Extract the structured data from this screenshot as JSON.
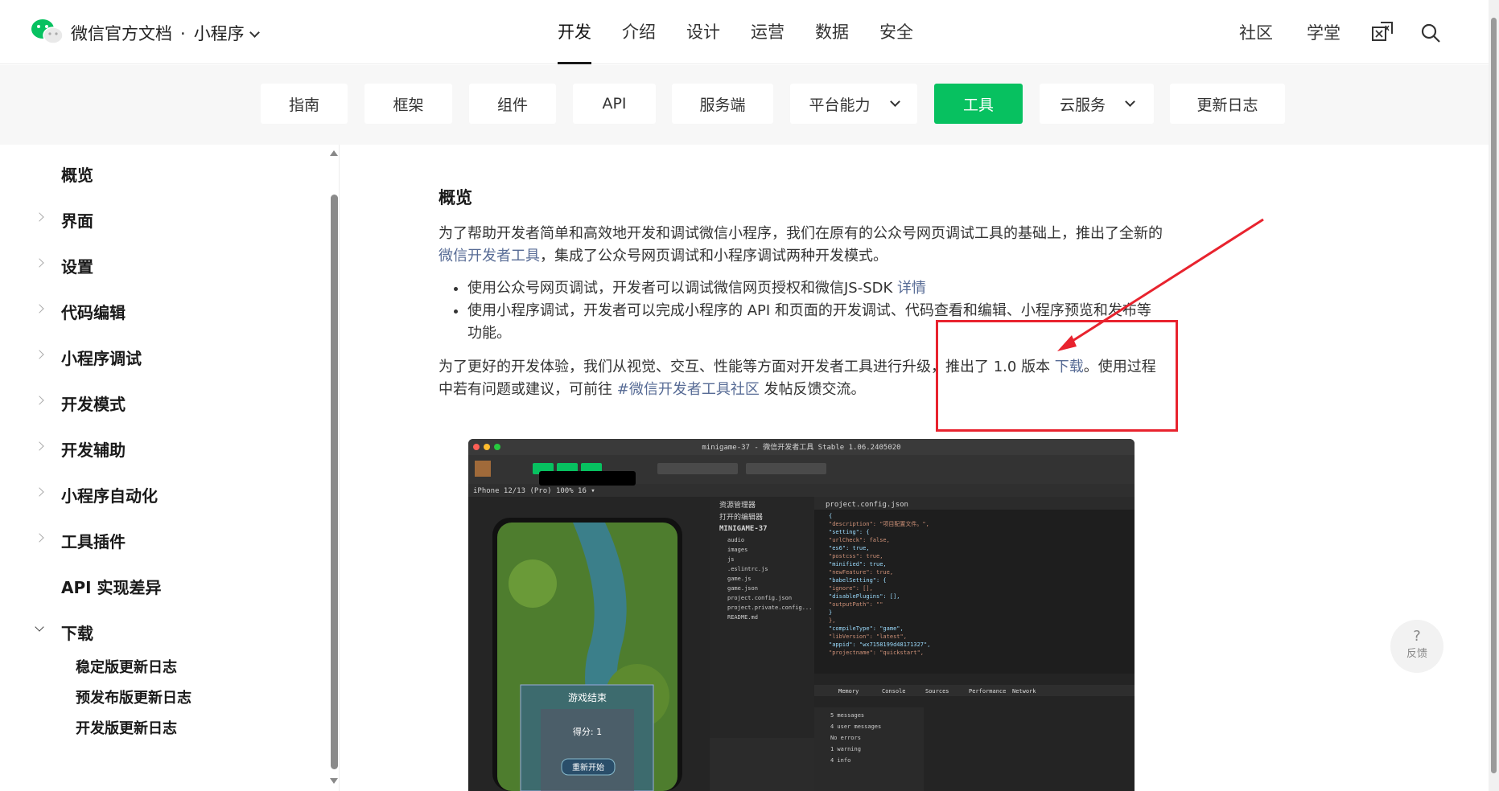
{
  "header": {
    "brand": "微信官方文档",
    "product": "小程序",
    "nav": [
      "开发",
      "介绍",
      "设计",
      "运营",
      "数据",
      "安全"
    ],
    "right": [
      "社区",
      "学堂"
    ]
  },
  "subnav": {
    "items": [
      "指南",
      "框架",
      "组件",
      "API",
      "服务端",
      "平台能力",
      "工具",
      "云服务",
      "更新日志"
    ]
  },
  "sidebar": {
    "items": [
      "概览",
      "界面",
      "设置",
      "代码编辑",
      "小程序调试",
      "开发模式",
      "开发辅助",
      "小程序自动化",
      "工具插件",
      "API 实现差异",
      "下载"
    ],
    "sub_items": [
      "稳定版更新日志",
      "预发布版更新日志",
      "开发版更新日志"
    ]
  },
  "content": {
    "title": "概览",
    "p1_a": "为了帮助开发者简单和高效地开发和调试微信小程序，我们在原有的公众号网页调试工具的基础上，推出了全新的 ",
    "p1_link": "微信开发者工具",
    "p1_b": "，集成了公众号网页调试和小程序调试两种开发模式。",
    "b1_a": "使用公众号网页调试，开发者可以调试微信网页授权和微信JS-SDK ",
    "b1_link": "详情",
    "b2": "使用小程序调试，开发者可以完成小程序的 API 和页面的开发调试、代码查看和编辑、小程序预览和发布等功能。",
    "p2_a": "为了更好的开发体验，我们从视觉、交互、性能等方面对开发者工具进行升级，推出了 1.0 版本 ",
    "p2_link1": "下载",
    "p2_b": "。使用过程中若有问题或建议，可前往 ",
    "p2_link2": "#微信开发者工具社区",
    "p2_c": " 发帖反馈交流。"
  },
  "screenshot": {
    "title": "minigame-37 - 微信开发者工具 Stable 1.06.2405020",
    "device": "iPhone 12/13 (Pro) 100% 16 ▾",
    "tab": "project.config.json",
    "explorer": "资源管理器",
    "open_editors": "打开的编辑器",
    "project": "MINIGAME-37",
    "files": [
      "audio",
      "images",
      "js",
      ".eslintrc.js",
      "game.js",
      "game.json",
      "project.config.json",
      "project.private.config...",
      "README.md"
    ],
    "game_over": "游戏结束",
    "score": "得分: 1",
    "restart": "重新开始",
    "code": [
      "{",
      "  \"description\": \"项目配置文件。\",",
      "  \"setting\": {",
      "    \"urlCheck\": false,",
      "    \"es6\": true,",
      "    \"postcss\": true,",
      "    \"minified\": true,",
      "    \"newFeature\": true,",
      "    \"babelSetting\": {",
      "      \"ignore\": [],",
      "      \"disablePlugins\": [],",
      "      \"outputPath\": \"\"",
      "    }",
      "  },",
      "  \"compileType\": \"game\",",
      "  \"libVersion\": \"latest\",",
      "  \"appid\": \"wx7158199d48171327\",",
      "  \"projectname\": \"quickstart\","
    ],
    "devtools_tabs": [
      "Memory",
      "Console",
      "Sources",
      "Performance",
      "Network"
    ],
    "console_rows": [
      "5 messages",
      "4 user messages",
      "No errors",
      "1 warning",
      "4 info"
    ]
  },
  "feedback": {
    "label": "反馈",
    "symbol": "?"
  },
  "colors": {
    "accent": "#07c160",
    "link": "#576b95",
    "annotation": "#e8232e"
  }
}
